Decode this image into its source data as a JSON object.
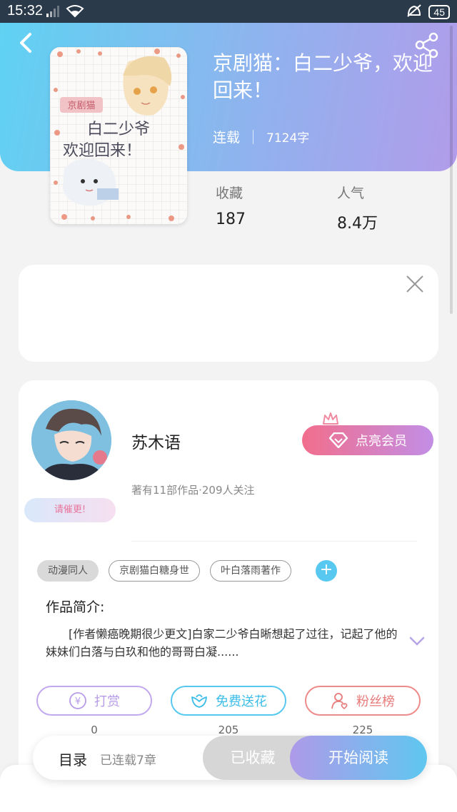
{
  "status_bar": {
    "time": "15:32",
    "battery": "45",
    "icons": [
      "wifi-icon",
      "signal-icon",
      "mute-icon"
    ]
  },
  "book": {
    "title": "京剧猫：白二少爷，欢迎回来！",
    "status": "连载",
    "word_count": "7124字",
    "cover_tag": "京剧猫",
    "cover_text": "白二少爷 欢迎回来！"
  },
  "stats": {
    "favorites_label": "收藏",
    "favorites_value": "187",
    "popularity_label": "人气",
    "popularity_value": "8.4万"
  },
  "author": {
    "name": "苏木语",
    "info": "著有11部作品·209人关注",
    "urge_label": "请催更!",
    "vip_label": "点亮会员"
  },
  "tags": [
    "动漫同人",
    "京剧猫白糖身世",
    "叶白落雨著作"
  ],
  "intro": {
    "title": "作品简介:",
    "text": "[作者懒癌晚期很少更文]白家二少爷白晰想起了过往，记起了他的妹妹们白落与白玖和他的哥哥白凝......"
  },
  "actions": [
    {
      "label": "打赏",
      "count": "0",
      "color": "#b79be8"
    },
    {
      "label": "免费送花",
      "count": "205",
      "color": "#56c8ef"
    },
    {
      "label": "粉丝榜",
      "count": "225",
      "color": "#ee8a8a"
    }
  ],
  "bottom_bar": {
    "toc_label": "目录",
    "toc_sub": "已连载7章",
    "favorited_label": "已收藏",
    "read_label": "开始阅读"
  }
}
